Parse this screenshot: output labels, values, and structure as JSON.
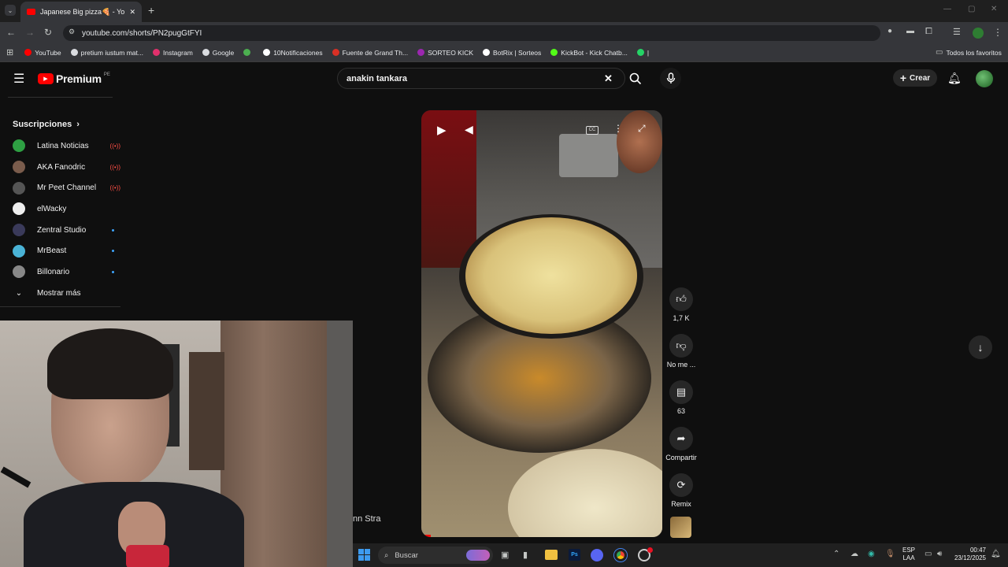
{
  "browser": {
    "tab_title": "Japanese Big pizza🍕 - YouTube",
    "url": "youtube.com/shorts/PN2pugGtFYI",
    "bookmarks": [
      {
        "label": "YouTube",
        "color": "#ff0000"
      },
      {
        "label": "pretium iustum mat...",
        "color": "#dadce0"
      },
      {
        "label": "Instagram",
        "color": "#e1306c"
      },
      {
        "label": "Google",
        "color": "#dadce0"
      },
      {
        "label": "",
        "color": "#4caf50"
      },
      {
        "label": "10Notificaciones",
        "color": "#ffffff"
      },
      {
        "label": "Fuente de Grand Th...",
        "color": "#d93025"
      },
      {
        "label": "SORTEO KICK",
        "color": "#9c27b0"
      },
      {
        "label": "BotRix | Sorteos",
        "color": "#ffffff"
      },
      {
        "label": "KickBot - Kick Chatb...",
        "color": "#53fc18"
      },
      {
        "label": "|",
        "color": "#25d366"
      }
    ],
    "all_bookmarks": "Todos los favoritos"
  },
  "youtube": {
    "logo_text": "Premium",
    "region": "PE",
    "search_query": "anakin tankara",
    "create_label": "Crear",
    "subscriptions_title": "Suscripciones",
    "subscriptions": [
      {
        "name": "Latina Noticias",
        "status": "live",
        "color": "#2ea043"
      },
      {
        "name": "AKA Fanodric",
        "status": "live",
        "color": "#7a5c4c"
      },
      {
        "name": "Mr Peet Channel",
        "status": "live",
        "color": "#555555"
      },
      {
        "name": "elWacky",
        "status": "",
        "color": "#eeeeee"
      },
      {
        "name": "Zentral Studio",
        "status": "new",
        "color": "#3a3a5a"
      },
      {
        "name": "MrBeast",
        "status": "new",
        "color": "#4ab3d6"
      },
      {
        "name": "Billonario",
        "status": "new",
        "color": "#888888"
      }
    ],
    "show_more": "Mostrar más",
    "actions": {
      "likes": "1,7 K",
      "dislike": "No me ...",
      "comments": "63",
      "share": "Compartir",
      "remix": "Remix"
    },
    "overlay_text": "nn Stra"
  },
  "taskbar": {
    "search_placeholder": "Buscar",
    "lang_top": "ESP",
    "lang_bottom": "LAA",
    "time": "00:47",
    "date": "23/12/2025"
  }
}
